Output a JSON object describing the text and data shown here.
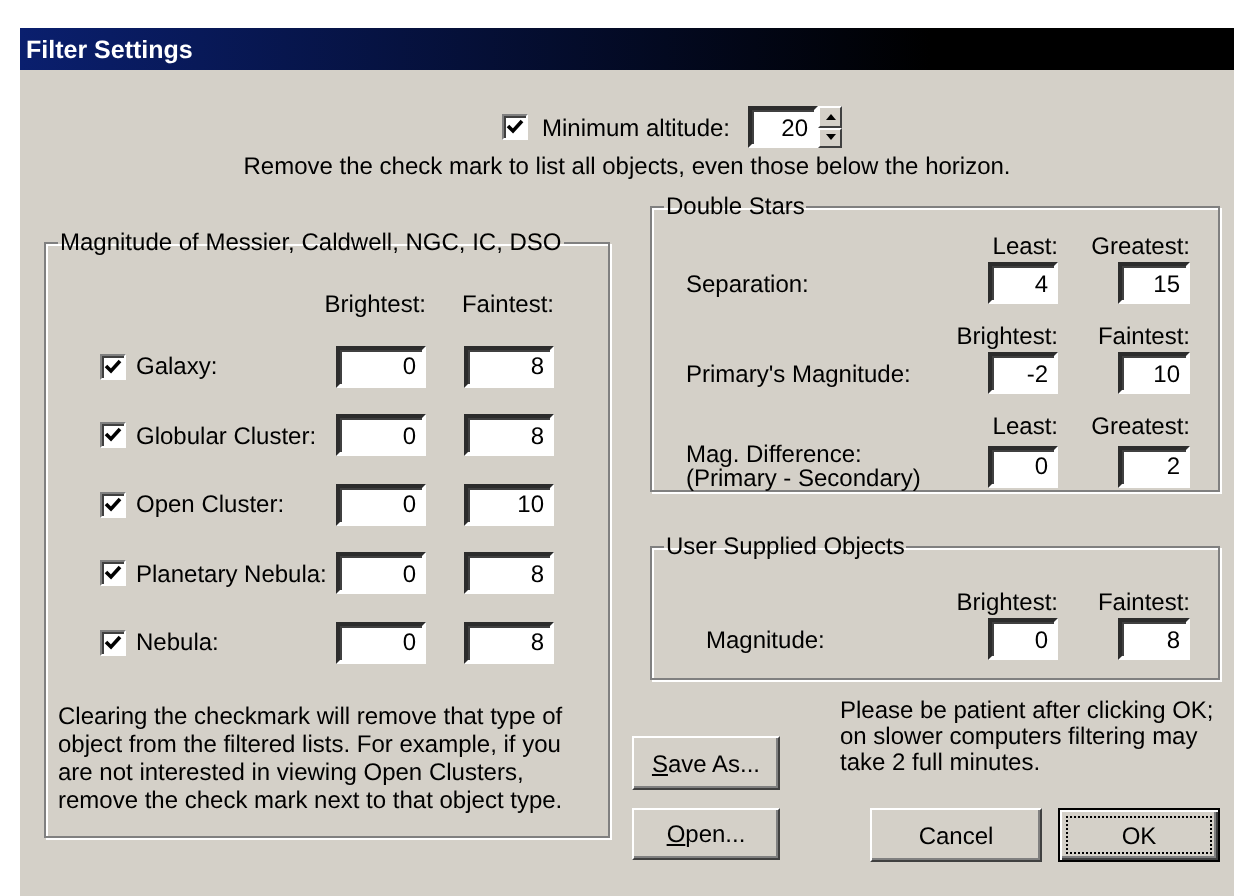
{
  "window": {
    "title": "Filter Settings"
  },
  "minimum_altitude": {
    "checked": true,
    "label": "Minimum altitude:",
    "value": "20",
    "hint": "Remove the check mark to list all objects, even those below the horizon."
  },
  "dso_group": {
    "legend": "Magnitude of Messier, Caldwell, NGC, IC, DSO",
    "columns": [
      "Brightest:",
      "Faintest:"
    ],
    "rows": [
      {
        "label": "Galaxy:",
        "checked": true,
        "brightest": "0",
        "faintest": "8"
      },
      {
        "label": "Globular Cluster:",
        "checked": true,
        "brightest": "0",
        "faintest": "8"
      },
      {
        "label": "Open Cluster:",
        "checked": true,
        "brightest": "0",
        "faintest": "10"
      },
      {
        "label": "Planetary Nebula:",
        "checked": true,
        "brightest": "0",
        "faintest": "8"
      },
      {
        "label": "Nebula:",
        "checked": true,
        "brightest": "0",
        "faintest": "8"
      }
    ],
    "note": "Clearing the checkmark will remove that type of\nobject from the filtered lists. For example, if you\nare not interested in viewing Open Clusters,\nremove the check mark next to that object type."
  },
  "double_stars": {
    "legend": "Double Stars",
    "rows": [
      {
        "label": "Separation:",
        "headers": [
          "Least:",
          "Greatest:"
        ],
        "values": [
          "4",
          "15"
        ]
      },
      {
        "label": "Primary's Magnitude:",
        "headers": [
          "Brightest:",
          "Faintest:"
        ],
        "values": [
          "-2",
          "10"
        ]
      },
      {
        "label": "Mag. Difference:\n(Primary - Secondary)",
        "headers": [
          "Least:",
          "Greatest:"
        ],
        "values": [
          "0",
          "2"
        ]
      }
    ]
  },
  "user_supplied_objects": {
    "legend": "User Supplied Objects",
    "rows": [
      {
        "label": "Magnitude:",
        "headers": [
          "Brightest:",
          "Faintest:"
        ],
        "values": [
          "0",
          "8"
        ]
      }
    ]
  },
  "note": "Please be patient after clicking OK;\non slower computers filtering may\ntake 2 full minutes.",
  "buttons": [
    {
      "label": "Save As...",
      "underline_first": true,
      "default": false
    },
    {
      "label": "Open...",
      "underline_first": true,
      "default": false
    },
    {
      "label": "Cancel",
      "underline_first": false,
      "default": false
    },
    {
      "label": "OK",
      "underline_first": false,
      "default": true
    }
  ]
}
